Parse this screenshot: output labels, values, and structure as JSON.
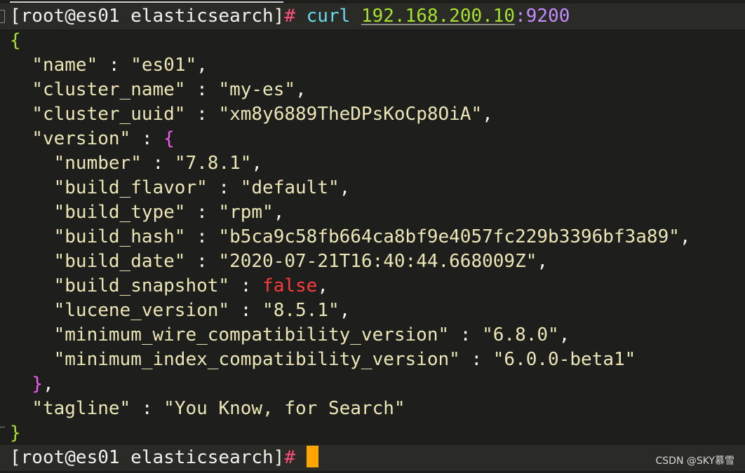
{
  "terminal": {
    "prompt1": {
      "user_host": "[root@es01 elasticsearch]",
      "hash": "#",
      "command": "curl",
      "ip": "192.168.200.10",
      "colon": ":",
      "port": "9200"
    },
    "json": {
      "open_brace": "{",
      "name_key": "\"name\"",
      "name_val": "\"es01\"",
      "cluster_name_key": "\"cluster_name\"",
      "cluster_name_val": "\"my-es\"",
      "cluster_uuid_key": "\"cluster_uuid\"",
      "cluster_uuid_val": "\"xm8y6889TheDPsKoCp8OiA\"",
      "version_key": "\"version\"",
      "version_open": "{",
      "number_key": "\"number\"",
      "number_val": "\"7.8.1\"",
      "build_flavor_key": "\"build_flavor\"",
      "build_flavor_val": "\"default\"",
      "build_type_key": "\"build_type\"",
      "build_type_val": "\"rpm\"",
      "build_hash_key": "\"build_hash\"",
      "build_hash_val": "\"b5ca9c58fb664ca8bf9e4057fc229b3396bf3a89\"",
      "build_date_key": "\"build_date\"",
      "build_date_val": "\"2020-07-21T16:40:44.668009Z\"",
      "build_snapshot_key": "\"build_snapshot\"",
      "build_snapshot_val": "false",
      "lucene_version_key": "\"lucene_version\"",
      "lucene_version_val": "\"8.5.1\"",
      "min_wire_key": "\"minimum_wire_compatibility_version\"",
      "min_wire_val": "\"6.8.0\"",
      "min_index_key": "\"minimum_index_compatibility_version\"",
      "min_index_val": "\"6.0.0-beta1\"",
      "version_close": "}",
      "tagline_key": "\"tagline\"",
      "tagline_val": "\"You Know, for Search\"",
      "close_brace": "}"
    },
    "prompt2": {
      "user_host": "[root@es01 elasticsearch]",
      "hash": "#"
    },
    "watermark": "CSDN @SKY慕雪"
  }
}
